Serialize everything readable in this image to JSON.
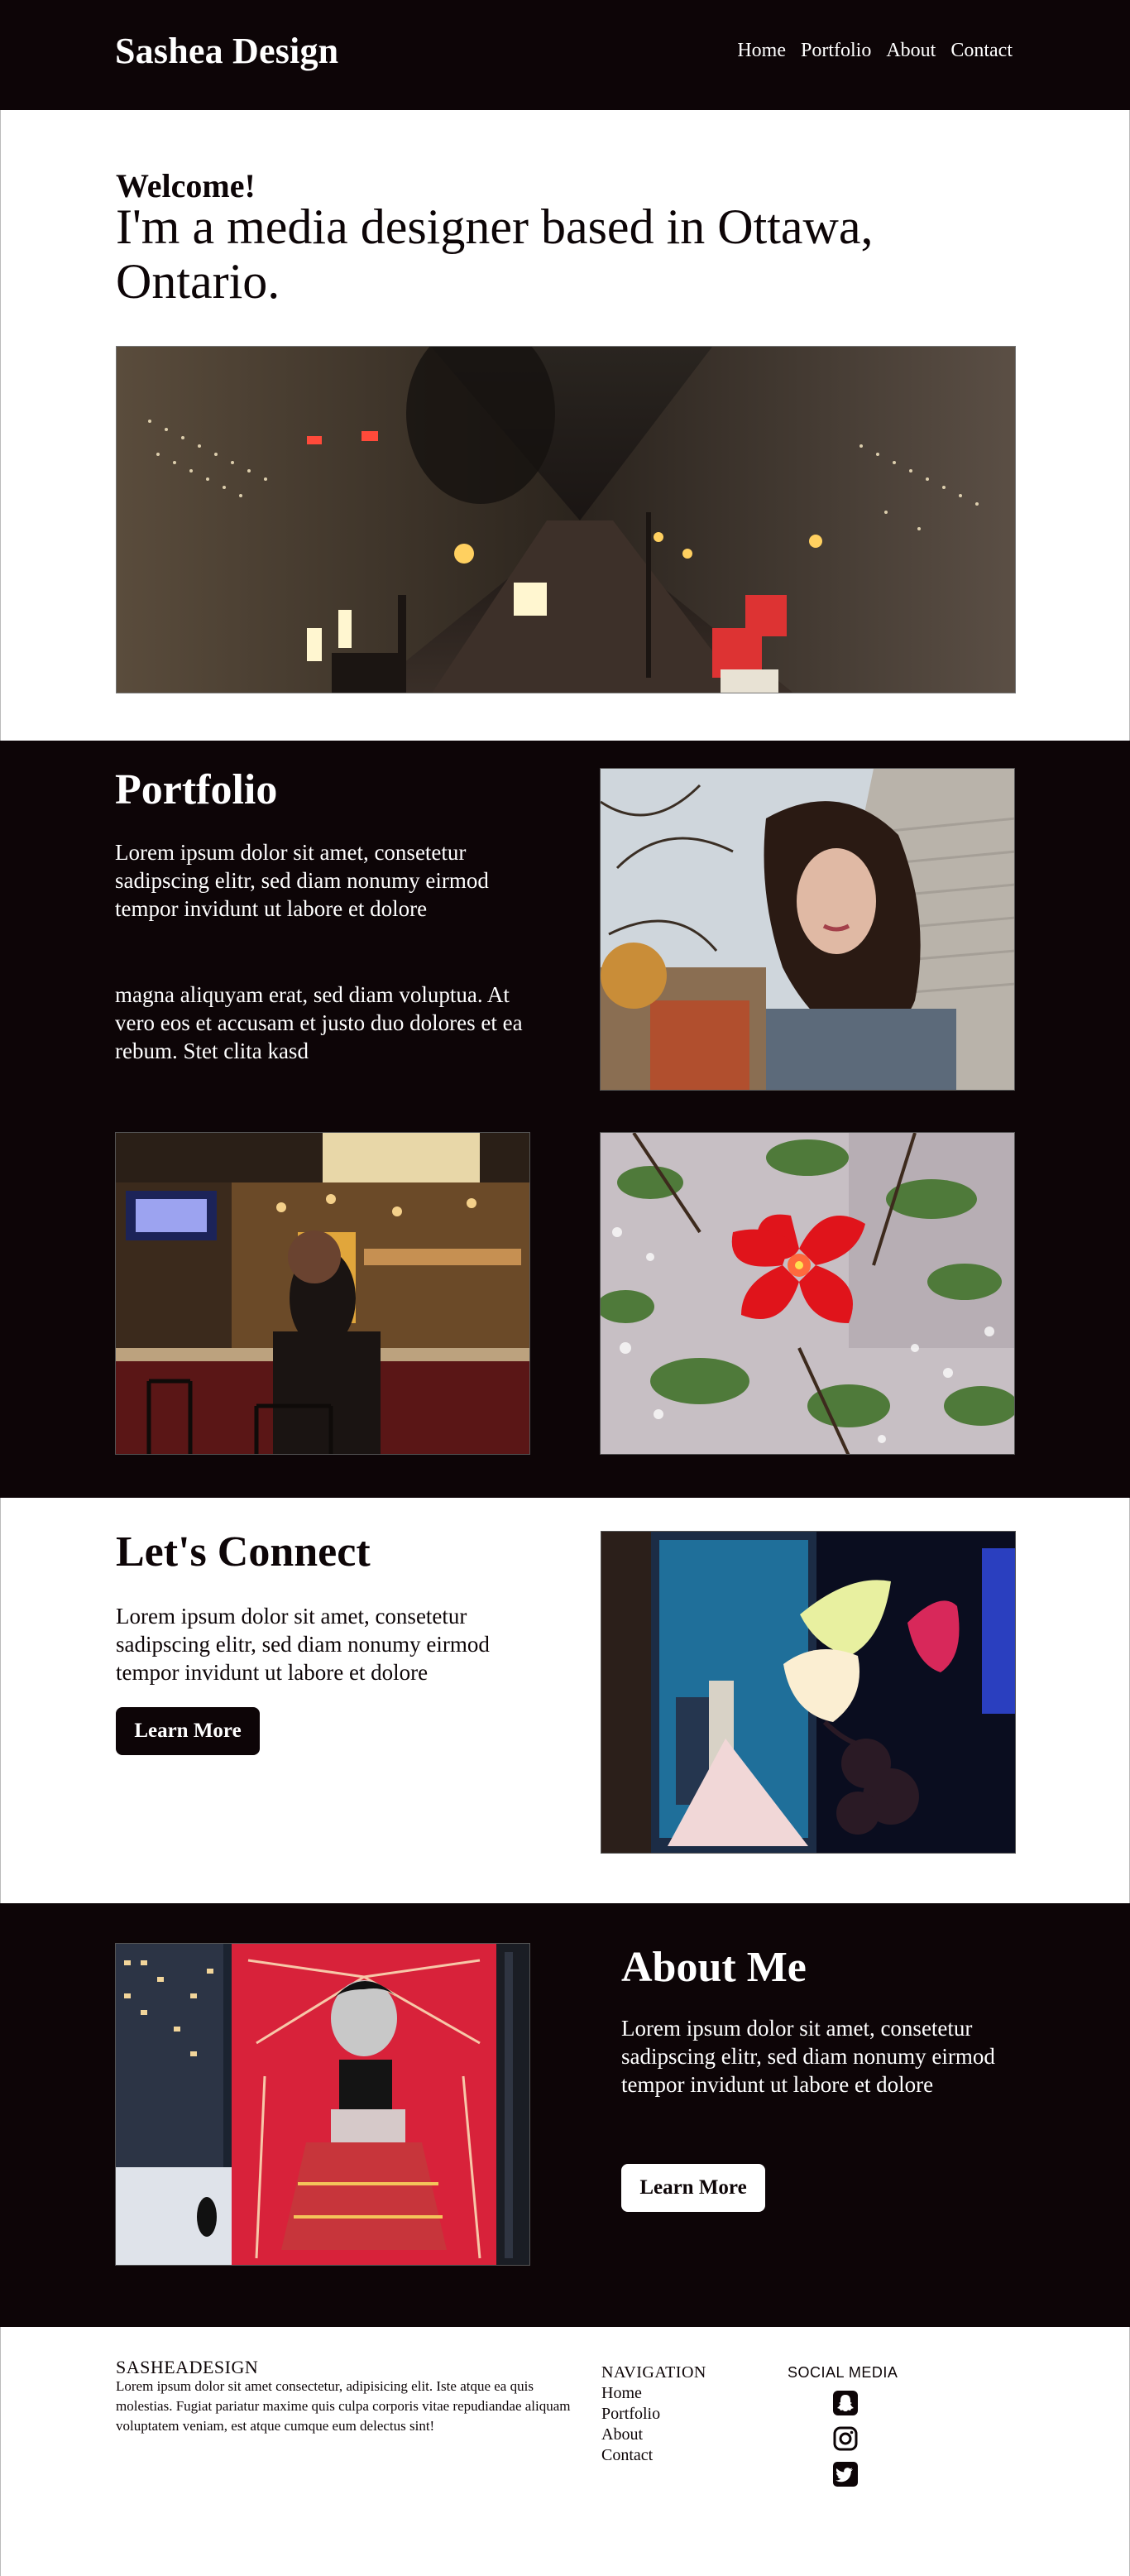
{
  "header": {
    "brand": "Sashea Design",
    "nav": [
      "Home",
      "Portfolio",
      "About",
      "Contact"
    ]
  },
  "hero": {
    "welcome": "Welcome!",
    "tagline": "I'm a media designer based in Ottawa, Ontario."
  },
  "portfolio": {
    "title": "Portfolio",
    "paragraph1": "Lorem ipsum dolor sit amet, consetetur sadipscing elitr, sed diam nonumy eirmod tempor invidunt ut labore et dolore",
    "paragraph2": "magna aliquyam erat, sed diam voluptua. At vero eos et accusam et justo duo dolores et ea rebum. Stet clita kasd"
  },
  "connect": {
    "title": "Let's Connect",
    "text": "Lorem ipsum dolor sit amet, consetetur sadipscing elitr, sed diam nonumy eirmod tempor invidunt ut labore et dolore",
    "button": "Learn More"
  },
  "about": {
    "title": "About Me",
    "text": "Lorem ipsum dolor sit amet, consetetur sadipscing elitr, sed diam nonumy eirmod tempor invidunt ut labore et dolore",
    "button": "Learn More"
  },
  "footer": {
    "brand": "SASHEADESIGN",
    "description": "Lorem ipsum dolor sit amet consectetur, adipisicing elit. Iste atque ea quis molestias. Fugiat pariatur maxime quis culpa corporis vitae repudiandae aliquam voluptatem veniam, est atque cumque eum delectus sint!",
    "nav_title": "NAVIGATION",
    "nav": [
      "Home",
      "Portfolio",
      "About",
      "Contact"
    ],
    "social_title": "SOCIAL MEDIA",
    "social": [
      "snapchat-icon",
      "instagram-icon",
      "twitter-icon"
    ]
  },
  "colors": {
    "dark": "#0d0507",
    "light": "#ffffff"
  }
}
